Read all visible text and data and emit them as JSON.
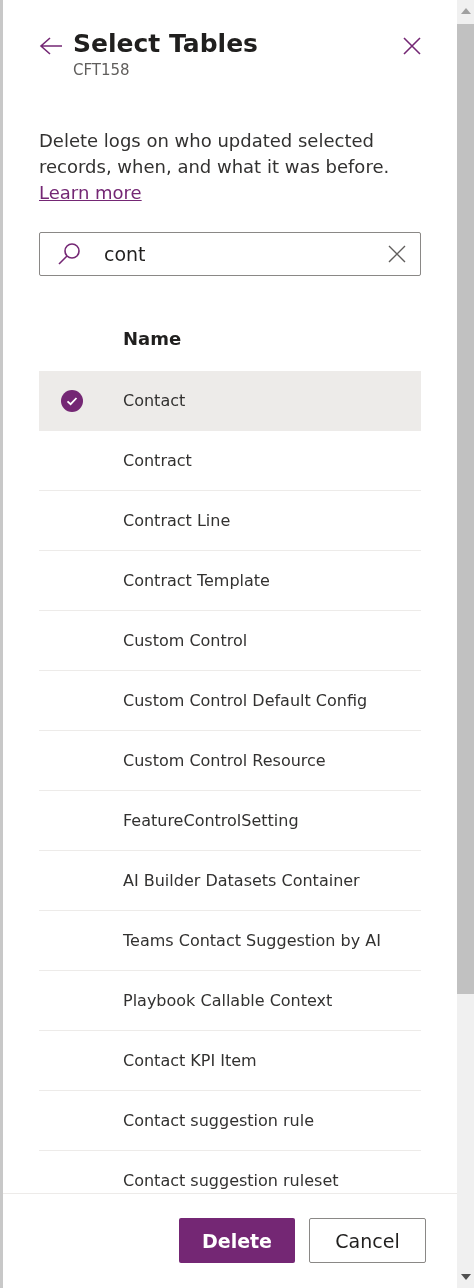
{
  "panel": {
    "title": "Select Tables",
    "subtitle": "CFT158"
  },
  "description": "Delete logs on who updated selected records, when, and what it was before.",
  "learn_more": "Learn more",
  "search": {
    "value": "cont"
  },
  "table": {
    "columns": [
      "Name"
    ],
    "rows": [
      {
        "name": "Contact",
        "selected": true
      },
      {
        "name": "Contract",
        "selected": false
      },
      {
        "name": "Contract Line",
        "selected": false
      },
      {
        "name": "Contract Template",
        "selected": false
      },
      {
        "name": "Custom Control",
        "selected": false
      },
      {
        "name": "Custom Control Default Config",
        "selected": false
      },
      {
        "name": "Custom Control Resource",
        "selected": false
      },
      {
        "name": "FeatureControlSetting",
        "selected": false
      },
      {
        "name": "AI Builder Datasets Container",
        "selected": false
      },
      {
        "name": "Teams Contact Suggestion by AI",
        "selected": false
      },
      {
        "name": "Playbook Callable Context",
        "selected": false
      },
      {
        "name": "Contact KPI Item",
        "selected": false
      },
      {
        "name": "Contact suggestion rule",
        "selected": false
      },
      {
        "name": "Contact suggestion ruleset",
        "selected": false
      }
    ]
  },
  "buttons": [
    {
      "label": "Delete",
      "kind": "primary"
    },
    {
      "label": "Cancel",
      "kind": "secondary"
    }
  ]
}
